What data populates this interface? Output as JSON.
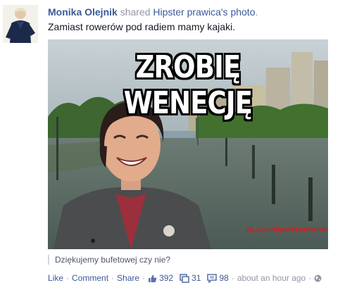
{
  "post": {
    "actor_name": "Monika Olejnik",
    "shared_text": "shared",
    "owner_name": "Hipster prawica's photo",
    "owner_suffix": ".",
    "message": "Zamiast rowerów pod radiem mamy kajaki."
  },
  "photo": {
    "overlay_text": "ZROBIĘ WENECJĘ",
    "watermark": "fb.com/hipsterprawica",
    "colors": {
      "sky": "#b8c4c8",
      "water": "#5f7068",
      "trees": "#3f6a34"
    }
  },
  "caption": {
    "text": "Dziękujemy bufetowej czy nie?"
  },
  "footer": {
    "like": "Like",
    "comment": "Comment",
    "share": "Share",
    "separator": "·",
    "likes_count": "392",
    "shares_count": "31",
    "comments_count": "98",
    "timestamp": "about an hour ago",
    "icons": {
      "like": "thumbs-up-icon",
      "share": "share-icon",
      "comment": "comment-icon",
      "privacy": "globe-icon"
    }
  },
  "colors": {
    "link": "#3b5998",
    "meta": "#9197a3",
    "text": "#141823"
  }
}
